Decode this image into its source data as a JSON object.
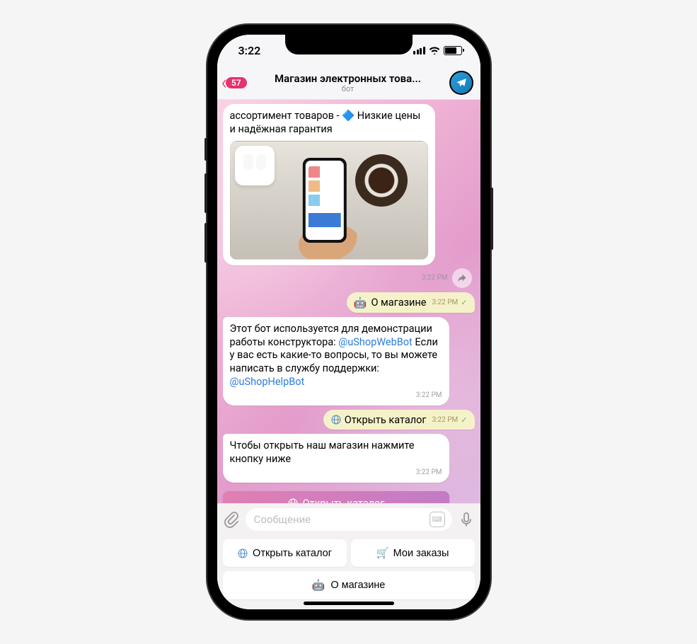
{
  "status": {
    "time": "3:22"
  },
  "header": {
    "back_badge": "57",
    "title": "Магазин электронных това...",
    "subtitle": "бот"
  },
  "messages": {
    "welcome_text": "ассортимент товаров - 🔷 Низкие цены и надёжная гарантия",
    "welcome_time": "3:22 PM",
    "out_about_label": "О магазине",
    "out_about_time": " 3:22 PM",
    "info_text_1": "Этот бот используется для демонстрации работы конструктора: ",
    "info_link_1": "@uShopWebBot",
    "info_text_2": " Если у вас есть какие-то вопросы, то вы можете написать в службу поддержки: ",
    "info_link_2": "@uShopHelpBot",
    "info_time": "3:22 PM",
    "out_catalog_label": "Открыть каталог",
    "out_catalog_time": "  3:22 PM",
    "open_store_text": "Чтобы открыть наш магазин нажмите кнопку ниже",
    "open_store_time": "3:22 PM",
    "inline_btn_label": "Открыть каталог"
  },
  "input": {
    "placeholder": "Сообщение"
  },
  "keyboard": {
    "btn_catalog": "Открыть каталог",
    "btn_orders": "Мои заказы",
    "btn_about": "О магазине"
  }
}
